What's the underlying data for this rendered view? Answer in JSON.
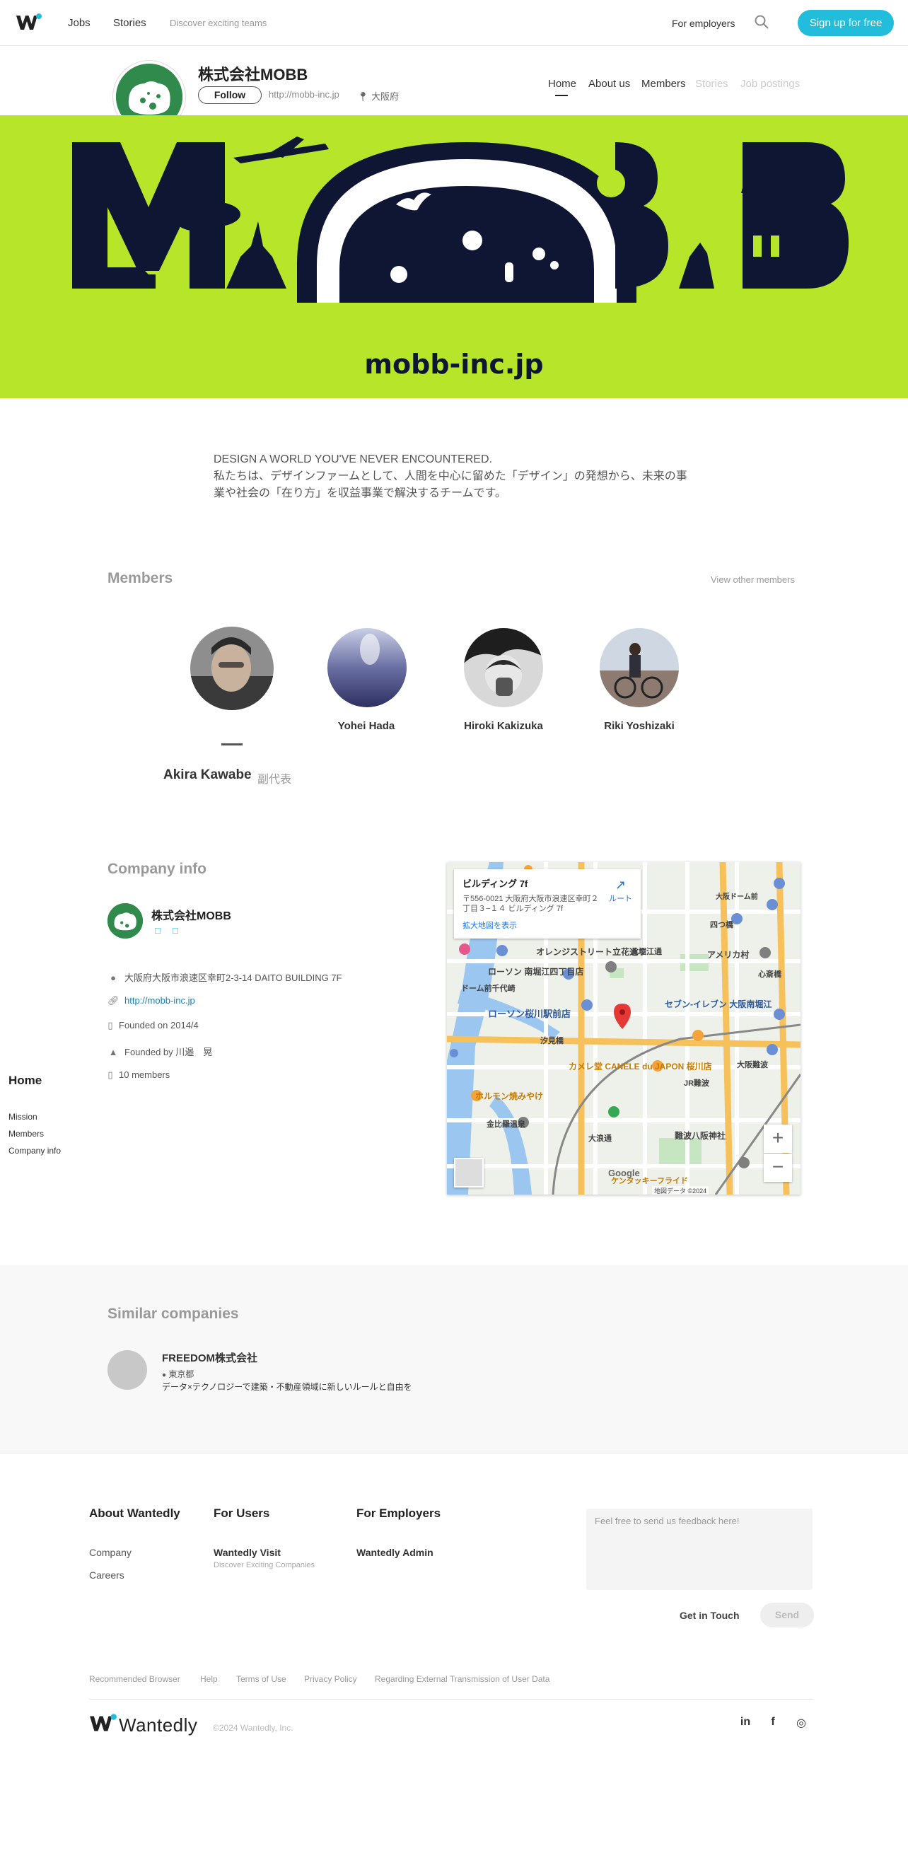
{
  "topnav": {
    "jobs": "Jobs",
    "stories": "Stories",
    "tagline": "Discover exciting teams",
    "for_employers": "For employers",
    "signup": "Sign up for free"
  },
  "company": {
    "name": "株式会社MOBB",
    "follow": "Follow",
    "url": "http://mobb-inc.jp",
    "location": "大阪府"
  },
  "tabs": [
    {
      "label": "Home",
      "active": true
    },
    {
      "label": "About us"
    },
    {
      "label": "Members"
    },
    {
      "label": "Stories",
      "disabled": true
    },
    {
      "label": "Job postings",
      "disabled": true
    }
  ],
  "banner": {
    "domain_text": "mobb-inc.jp",
    "color": "#b6e52a"
  },
  "mission": {
    "line1": "DESIGN A WORLD YOU'VE NEVER ENCOUNTERED.",
    "line2": "私たちは、デザインファームとして、人間を中心に留めた「デザイン」の発想から、未来の事業や社会の「在り方」を収益事業で解決するチームです。"
  },
  "members": {
    "title": "Members",
    "view_other": "View other members",
    "list": [
      {
        "name": "Akira Kawabe",
        "role": "副代表",
        "selected": true
      },
      {
        "name": "Yohei Hada"
      },
      {
        "name": "Hiroki Kakizuka"
      },
      {
        "name": "Riki Yoshizaki"
      }
    ]
  },
  "company_info": {
    "title": "Company info",
    "name": "株式会社MOBB",
    "address": "大阪府大阪市浪速区幸町2-3-14 DAITO BUILDING 7F",
    "url": "http://mobb-inc.jp",
    "founded": "Founded on 2014/4",
    "founded_by": "Founded by 川邉　晃",
    "members": "10 members"
  },
  "side_nav": {
    "home": "Home",
    "items": [
      "Mission",
      "Members",
      "Company info"
    ]
  },
  "map": {
    "card_title": "ビルディング 7f",
    "card_addr": "〒556-0021 大阪府大阪市浪速区幸町２丁目３−１４ ビルディング 7f",
    "card_link": "拡大地図を表示",
    "route": "ルート",
    "labels": [
      "ローソン 南堀江四丁目店",
      "ローソン桜川駅前店",
      "セブン-イレブン 大阪南堀江",
      "カメレ堂 CANELE du JAPON 桜川店",
      "ホルモン焼みやけ",
      "アメリカ村",
      "難波八阪神社",
      "大阪難波",
      "JR難波",
      "オレンジストリート立花通り",
      "ドーム前千代崎",
      "大阪ドーム前",
      "汐見橋",
      "金比羅温泉",
      "ケンタッキーフライド",
      "心斎橋",
      "四つ橋",
      "北堀江通",
      "大浪通"
    ],
    "google": "Google",
    "copyright": "地図データ ©2024"
  },
  "similar": {
    "title": "Similar companies",
    "name": "FREEDOM株式会社",
    "location": "東京都",
    "desc": "データ×テクノロジーで建築・不動産領域に新しいルールと自由を"
  },
  "footer": {
    "about_head": "About Wantedly",
    "about_items": [
      "Company",
      "Careers"
    ],
    "users_head": "For Users",
    "users_item": "Wantedly Visit",
    "users_sub": "Discover Exciting Companies",
    "employers_head": "For Employers",
    "employers_item": "Wantedly Admin",
    "feedback_placeholder": "Feel free to send us feedback here!",
    "get_in_touch": "Get in Touch",
    "send": "Send",
    "legal": [
      "Recommended Browser",
      "Help",
      "Terms of Use",
      "Privacy Policy",
      "Regarding External Transmission of User Data"
    ],
    "brand": "Wantedly",
    "copyright": "©2024 Wantedly, Inc.",
    "social": [
      "in",
      "f",
      "◎"
    ]
  },
  "colors": {
    "accent": "#21bddb",
    "brand_green": "#2f8a4b",
    "banner_green": "#b6e52a",
    "banner_dark": "#0f1633"
  }
}
